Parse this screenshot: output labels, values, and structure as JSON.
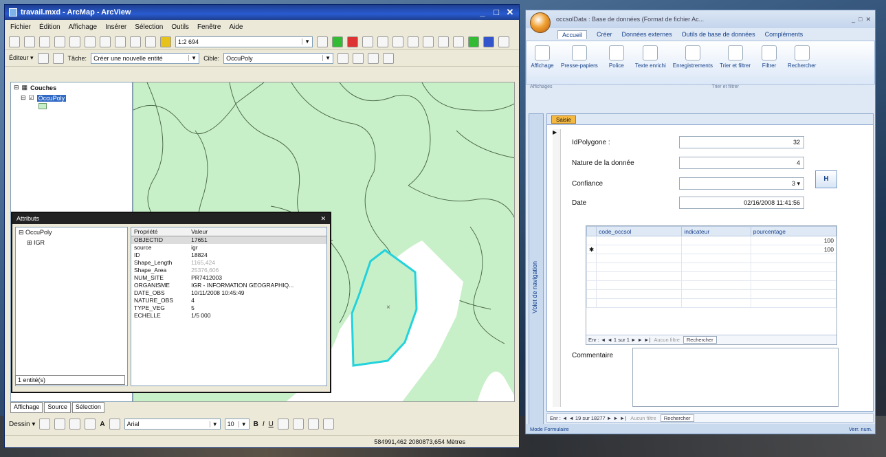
{
  "arcmap": {
    "title": "travail.mxd - ArcMap - ArcView",
    "window_buttons": [
      "_",
      "□",
      "✕"
    ],
    "menu": [
      "Fichier",
      "Édition",
      "Affichage",
      "Insérer",
      "Sélection",
      "Outils",
      "Fenêtre",
      "Aide"
    ],
    "scale": "1:2 694",
    "editor_label": "Éditeur ▾",
    "task_label": "Tâche:",
    "task_value": "Créer une nouvelle entité",
    "target_label": "Cible:",
    "target_value": "OccuPoly",
    "toc": {
      "root": "Couches",
      "layer": "OccuPoly"
    },
    "toc_tabs": [
      "Affichage",
      "Source",
      "Sélection"
    ],
    "draw_label": "Dessin ▾",
    "font_name": "Arial",
    "font_size": "10",
    "bold": "B",
    "italic": "I",
    "underline": "U",
    "text_tool": "A",
    "coords": "584991,462  2080873,654 Mètres"
  },
  "attributes": {
    "title": "Attributs",
    "tree_root": "OccuPoly",
    "tree_child": "IGR",
    "count": "1 entité(s)",
    "headers": [
      "Propriété",
      "Valeur"
    ],
    "rows": [
      {
        "prop": "OBJECTID",
        "val": "17651"
      },
      {
        "prop": "source",
        "val": "igr"
      },
      {
        "prop": "ID",
        "val": "18824"
      },
      {
        "prop": "Shape_Length",
        "val": "1165,424"
      },
      {
        "prop": "Shape_Area",
        "val": "25376,606"
      },
      {
        "prop": "NUM_SITE",
        "val": "PR7412003"
      },
      {
        "prop": "ORGANISME",
        "val": "IGR - INFORMATION GEOGRAPHIQ..."
      },
      {
        "prop": "DATE_OBS",
        "val": "10/11/2008 10:45:49"
      },
      {
        "prop": "NATURE_OBS",
        "val": "4"
      },
      {
        "prop": "TYPE_VEG",
        "val": "5"
      },
      {
        "prop": "ECHELLE",
        "val": "1/5 000"
      }
    ]
  },
  "access": {
    "title": "occsolData : Base de données (Format de fichier Ac...",
    "ribbon_tabs": [
      "Accueil",
      "Créer",
      "Données externes",
      "Outils de base de données",
      "Compléments"
    ],
    "ribbon_buttons": [
      "Affichage",
      "Presse-papiers",
      "Police",
      "Texte enrichi",
      "Enregistrements",
      "Trier et filtrer",
      "Filtrer",
      "Rechercher"
    ],
    "group_labels": [
      "Affichages",
      "Trier et filtrer"
    ],
    "nav_pane": "Volet de navigation",
    "form_tab": "Saisie",
    "fields": {
      "idpolygone_label": "IdPolygone :",
      "idpolygone_value": "32",
      "nature_label": "Nature de la donnée",
      "nature_value": "4",
      "confiance_label": "Confiance",
      "confiance_value": "3",
      "date_label": "Date",
      "date_value": "02/16/2008 11:41:56"
    },
    "nav_button": "H",
    "subform": {
      "headers": [
        "code_occsol",
        "indicateur",
        "pourcentage"
      ],
      "rows": [
        {
          "code": "",
          "ind": "",
          "pct": "100"
        },
        {
          "code": "",
          "ind": "",
          "pct": "100"
        }
      ],
      "nav": "Enr : ◄ ◄ 1 sur 1 ► ► ►|",
      "filter": "Aucun filtre",
      "search": "Rechercher"
    },
    "comment_label": "Commentaire",
    "record_nav": "Enr : ◄ ◄ 19 sur 18277 ► ► ►|",
    "record_filter": "Aucun filtre",
    "record_search": "Rechercher",
    "status_left": "Mode Formulaire",
    "status_right": "Verr. num."
  }
}
